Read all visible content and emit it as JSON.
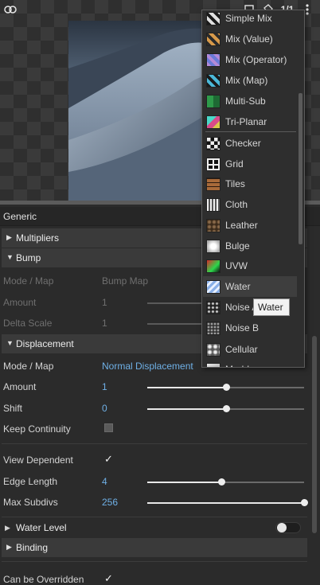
{
  "toolbar": {
    "left_icon": "layer-toggle-icon",
    "frame_icon": "frame-icon",
    "bucket_icon": "paint-bucket-icon",
    "ratio_label": "1/1",
    "more_icon": "more-vertical-icon"
  },
  "panel": {
    "title": "Generic",
    "sections": {
      "multipliers": "Multipliers",
      "bump": "Bump",
      "displacement": "Displacement",
      "water_level": "Water Level",
      "binding": "Binding"
    },
    "bump": {
      "mode_label": "Mode / Map",
      "mode_value": "Bump Map",
      "amount_label": "Amount",
      "amount_value": "1",
      "amount_fraction": 0.5,
      "delta_label": "Delta Scale",
      "delta_value": "1",
      "delta_fraction": 0.5
    },
    "displacement": {
      "mode_label": "Mode / Map",
      "mode_value": "Normal Displacement",
      "amount_label": "Amount",
      "amount_value": "1",
      "amount_fraction": 0.5,
      "shift_label": "Shift",
      "shift_value": "0",
      "shift_fraction": 0.5,
      "keep_label": "Keep Continuity",
      "keep_checked": false,
      "view_label": "View Dependent",
      "view_checked": true,
      "edge_label": "Edge Length",
      "edge_value": "4",
      "edge_fraction": 0.47,
      "maxsub_label": "Max Subdivs",
      "maxsub_value": "256",
      "maxsub_fraction": 1.0
    },
    "water_level_enabled": false,
    "overridden_label": "Can be Overridden",
    "overridden_checked": true
  },
  "menu": {
    "items": [
      {
        "label": "Simple Mix",
        "icon": "simple-mix-icon"
      },
      {
        "label": "Mix (Value)",
        "icon": "mix-value-icon"
      },
      {
        "label": "Mix (Operator)",
        "icon": "mix-operator-icon"
      },
      {
        "label": "Mix (Map)",
        "icon": "mix-map-icon"
      },
      {
        "label": "Multi-Sub",
        "icon": "multi-sub-icon"
      },
      {
        "label": "Tri-Planar",
        "icon": "tri-planar-icon"
      },
      {
        "label": "Checker",
        "icon": "checker-icon"
      },
      {
        "label": "Grid",
        "icon": "grid-icon"
      },
      {
        "label": "Tiles",
        "icon": "tiles-icon"
      },
      {
        "label": "Cloth",
        "icon": "cloth-icon"
      },
      {
        "label": "Leather",
        "icon": "leather-icon"
      },
      {
        "label": "Bulge",
        "icon": "bulge-icon"
      },
      {
        "label": "UVW",
        "icon": "uvw-icon"
      },
      {
        "label": "Water",
        "icon": "water-icon"
      },
      {
        "label": "Noise A",
        "icon": "noise-a-icon"
      },
      {
        "label": "Noise B",
        "icon": "noise-b-icon"
      },
      {
        "label": "Cellular",
        "icon": "cellular-icon"
      },
      {
        "label": "Marble",
        "icon": "marble-icon"
      }
    ],
    "highlighted": "Water"
  },
  "tooltip": "Water"
}
